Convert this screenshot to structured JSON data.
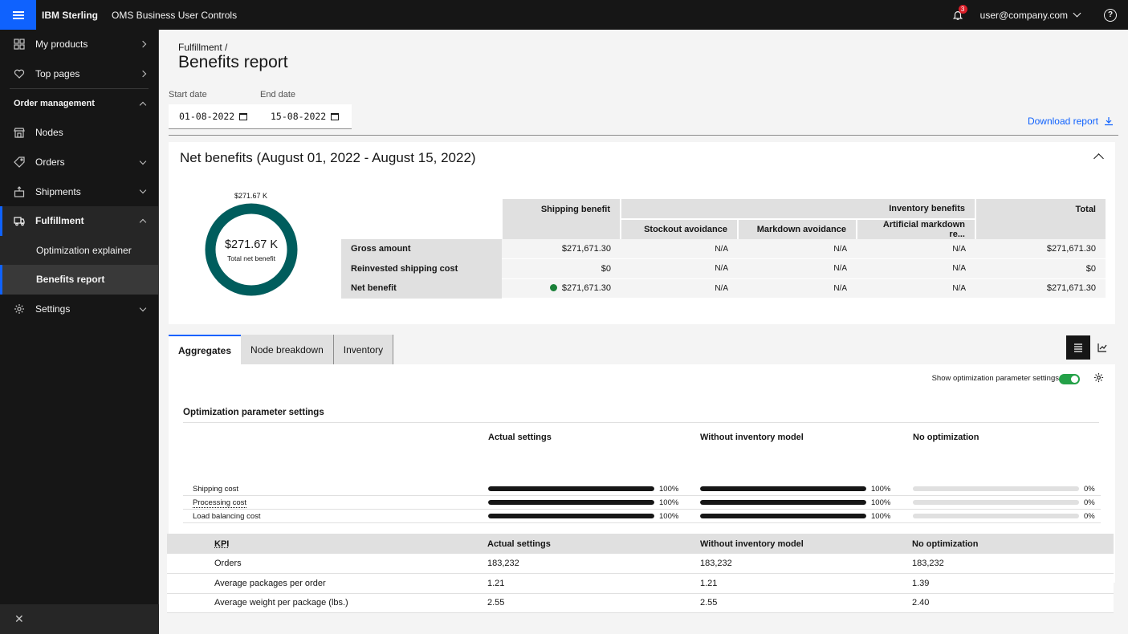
{
  "header": {
    "brand": "IBM Sterling",
    "product": "OMS Business User Controls",
    "notification_count": "3",
    "user": "user@company.com",
    "help": "?"
  },
  "sidebar": {
    "items_top": [
      {
        "label": "My products",
        "icon": "grid-icon"
      },
      {
        "label": "Top pages",
        "icon": "heart-icon"
      }
    ],
    "section": "Order management",
    "items": [
      {
        "label": "Nodes",
        "icon": "store-icon"
      },
      {
        "label": "Orders",
        "icon": "tag-icon"
      },
      {
        "label": "Shipments",
        "icon": "package-icon"
      },
      {
        "label": "Fulfillment",
        "icon": "truck-icon"
      }
    ],
    "sub_items": [
      "Optimization explainer",
      "Benefits report"
    ],
    "settings": "Settings",
    "close": "✕"
  },
  "page": {
    "breadcrumb": "Fulfillment  /",
    "title": "Benefits report",
    "start_label": "Start date",
    "start_value": "01-08-2022",
    "end_label": "End date",
    "end_value": "15-08-2022",
    "download": "Download report"
  },
  "net_benefits": {
    "title": "Net benefits (August 01, 2022 - August 15, 2022)",
    "donut_top": "$271.67 K",
    "donut_value": "$271.67 K",
    "donut_sub": "Total net benefit",
    "donut_color": "#005d5d",
    "headers": {
      "shipping": "Shipping benefit",
      "inventory": "Inventory benefits",
      "total": "Total",
      "stockout": "Stockout avoidance",
      "markdown": "Markdown avoidance",
      "artificial": "Artificial markdown re..."
    },
    "rows": [
      {
        "label": "Gross amount",
        "shipping": "$271,671.30",
        "stockout": "N/A",
        "markdown": "N/A",
        "artificial": "N/A",
        "total": "$271,671.30"
      },
      {
        "label": "Reinvested shipping cost",
        "shipping": "$0",
        "stockout": "N/A",
        "markdown": "N/A",
        "artificial": "N/A",
        "total": "$0"
      },
      {
        "label": "Net benefit",
        "shipping": "$271,671.30",
        "stockout": "N/A",
        "markdown": "N/A",
        "artificial": "N/A",
        "total": "$271,671.30"
      }
    ]
  },
  "tabs": [
    "Aggregates",
    "Node breakdown",
    "Inventory"
  ],
  "aggregates": {
    "toggle_label": "Show optimization parameter settings",
    "ops_title": "Optimization parameter settings",
    "columns": [
      "Actual settings",
      "Without inventory model",
      "No optimization"
    ],
    "params": [
      {
        "name": "Shipping cost",
        "values": [
          100,
          100,
          0
        ],
        "labels": [
          "100%",
          "100%",
          "0%"
        ]
      },
      {
        "name": "Processing cost",
        "values": [
          100,
          100,
          0
        ],
        "labels": [
          "100%",
          "100%",
          "0%"
        ]
      },
      {
        "name": "Load balancing cost",
        "values": [
          100,
          100,
          0
        ],
        "labels": [
          "100%",
          "100%",
          "0%"
        ]
      }
    ],
    "kpi_header": "KPI",
    "kpi_rows": [
      {
        "name": "Orders",
        "values": [
          "183,232",
          "183,232",
          "183,232"
        ]
      },
      {
        "name": "Average packages per order",
        "values": [
          "1.21",
          "1.21",
          "1.39"
        ]
      },
      {
        "name": "Average weight per package (lbs.)",
        "values": [
          "2.55",
          "2.55",
          "2.40"
        ]
      }
    ]
  }
}
